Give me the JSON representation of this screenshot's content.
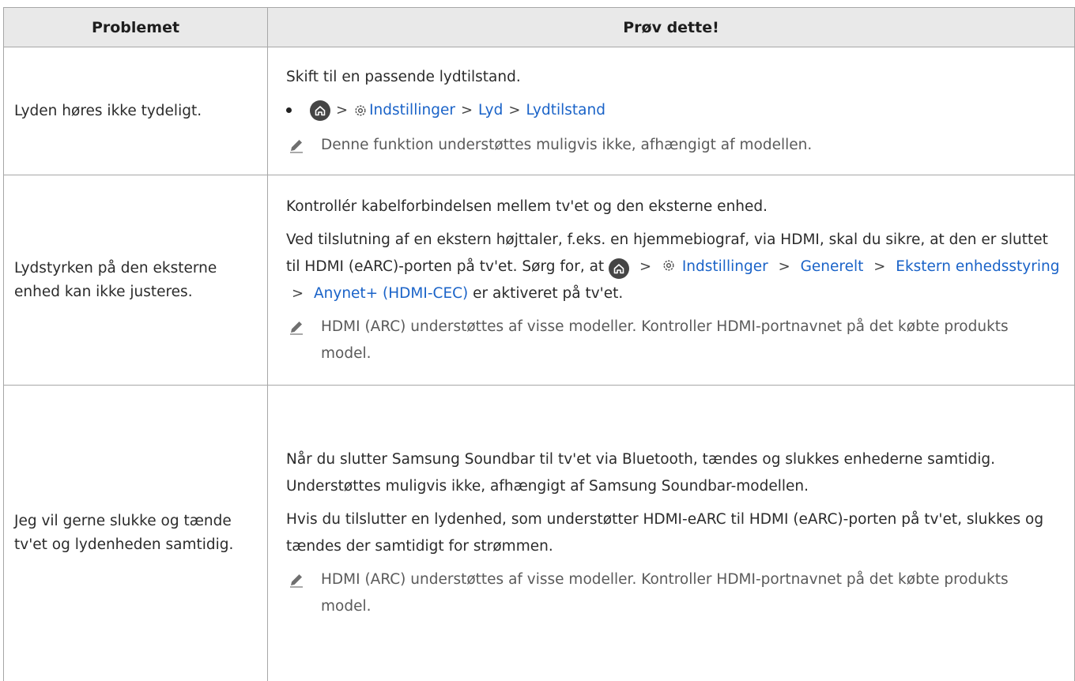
{
  "header": {
    "col_problem": "Problemet",
    "col_solution": "Prøv dette!"
  },
  "rows": [
    {
      "problem": "Lyden høres ikke tydeligt.",
      "intro": "Skift til en passende lydtilstand.",
      "path": {
        "settings": "Indstillinger",
        "sound": "Lyd",
        "mode": "Lydtilstand"
      },
      "note": "Denne funktion understøttes muligvis ikke, afhængigt af modellen."
    },
    {
      "problem": "Lydstyrken på den eksterne enhed kan ikke justeres.",
      "p1": "Kontrollér kabelforbindelsen mellem tv'et og den eksterne enhed.",
      "p2_start": "Ved tilslutning af en ekstern højttaler, f.eks. en hjemmebiograf, via HDMI, skal du sikre, at den er sluttet til HDMI (eARC)-porten på tv'et. Sørg for, at",
      "path": {
        "settings": "Indstillinger",
        "general": "Generelt",
        "ext_device": "Ekstern enhedsstyring",
        "anynet": "Anynet+ (HDMI-CEC)"
      },
      "p2_end": "er aktiveret på tv'et.",
      "note": "HDMI (ARC) understøttes af visse modeller. Kontroller HDMI-portnavnet på det købte produkts model."
    },
    {
      "problem": "Jeg vil gerne slukke og tænde tv'et og lydenheden samtidig.",
      "p1": "Når du slutter Samsung Soundbar til tv'et via Bluetooth, tændes og slukkes enhederne samtidig. Understøttes muligvis ikke, afhængigt af Samsung Soundbar-modellen.",
      "p2": "Hvis du tilslutter en lydenhed, som understøtter HDMI-eARC til HDMI (eARC)-porten på tv'et, slukkes og tændes der samtidigt for strømmen.",
      "note": "HDMI (ARC) understøttes af visse modeller. Kontroller HDMI-portnavnet på det købte produkts model."
    }
  ],
  "glyphs": {
    "separator": ">"
  },
  "colors": {
    "link": "#1a63c8",
    "header_bg": "#e9e9e9",
    "border": "#a7a7a7"
  }
}
